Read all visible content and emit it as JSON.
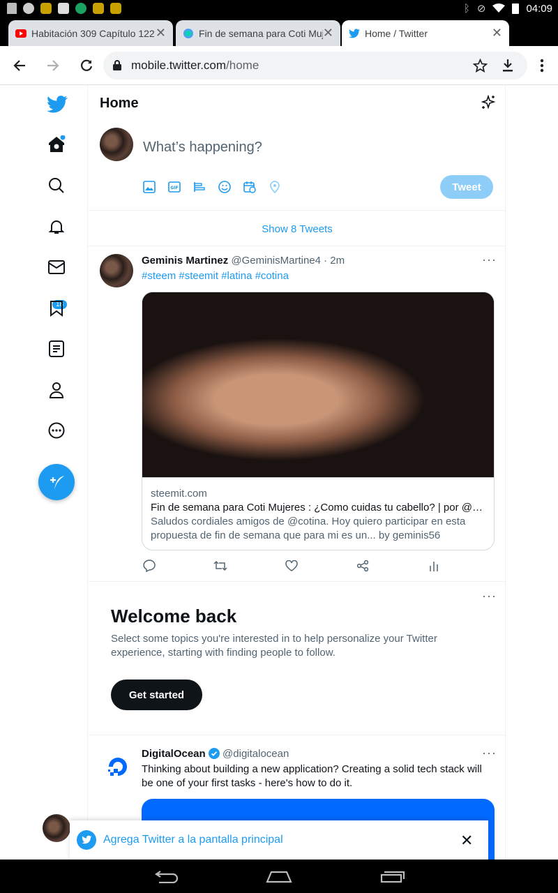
{
  "status_bar": {
    "time": "04:09"
  },
  "browser": {
    "tabs": [
      {
        "title": "Habitación 309 Capítulo 122",
        "active": false
      },
      {
        "title": "Fin de semana para Coti Mujeres",
        "active": false
      },
      {
        "title": "Home / Twitter",
        "active": true
      }
    ],
    "url_host": "mobile.twitter.com",
    "url_path": "/home"
  },
  "sidebar": {
    "notifications_count": "18"
  },
  "header": {
    "title": "Home"
  },
  "composer": {
    "placeholder": "What’s happening?",
    "tweet_label": "Tweet"
  },
  "timeline": {
    "show_more": "Show 8 Tweets",
    "tweet1": {
      "name": "Geminis Martinez",
      "handle": "@GeminisMartine4 · 2m",
      "hashtags": "#steem #steemit #latina #cotina",
      "card_domain": "steemit.com",
      "card_title": "Fin de semana para Coti Mujeres : ¿Como cuidas tu cabello? | por @ge...",
      "card_desc": "Saludos cordiales amigos de @cotina. Hoy quiero participar en esta propuesta de fin de semana que para mi es un... by geminis56"
    },
    "welcome": {
      "title": "Welcome back",
      "text": "Select some topics you're interested in to help personalize your Twitter experience, starting with finding people to follow.",
      "button": "Get started"
    },
    "tweet2": {
      "name": "DigitalOcean",
      "handle": "@digitalocean",
      "text": "Thinking about building a new application? Creating a solid tech stack will be one of your first tasks - here's how to do it."
    }
  },
  "install_banner": {
    "text": "Agrega Twitter a la pantalla principal"
  },
  "colors": {
    "accent": "#1d9bf0",
    "text": "#0f1419",
    "muted": "#536471"
  }
}
